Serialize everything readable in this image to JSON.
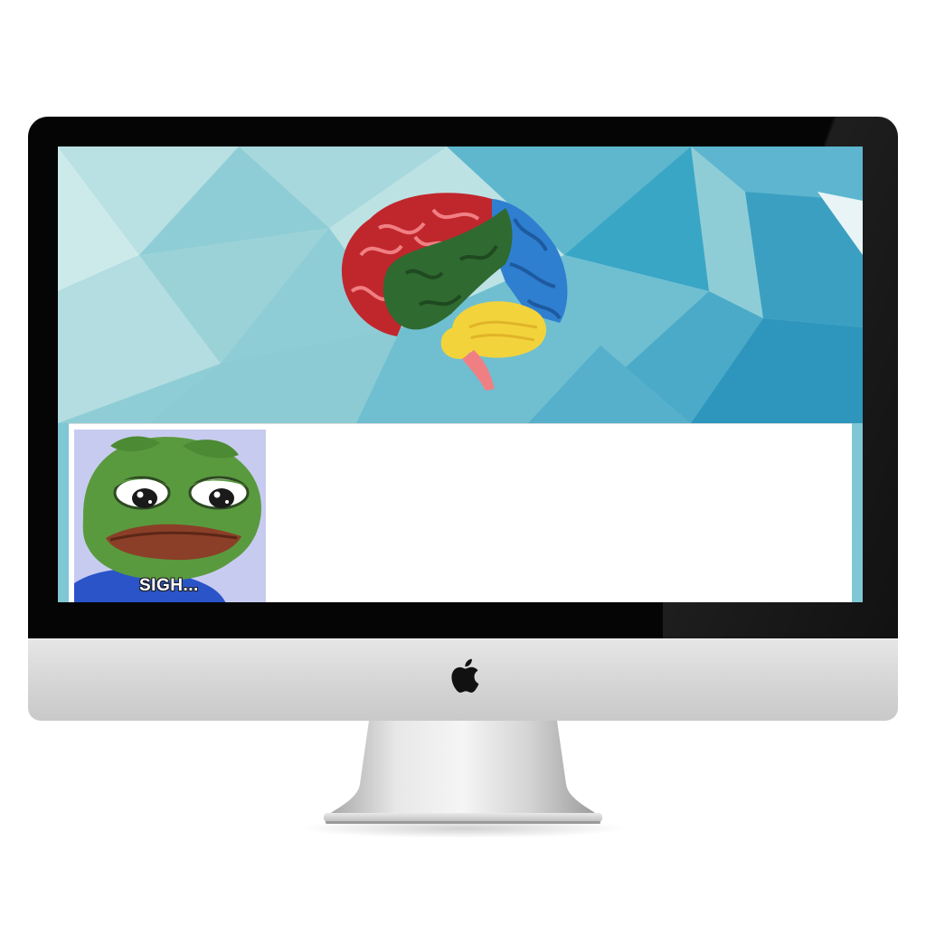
{
  "device": {
    "type": "desktop monitor",
    "logo_icon": "apple-logo-icon",
    "colors": {
      "bezel": "#050505",
      "chin": "#d9d9d9"
    }
  },
  "screen": {
    "wallpaper": {
      "icon": "brain-illustration",
      "colors": {
        "frontal": "#c0272d",
        "temporal": "#2f6a31",
        "parietal": "#2f7fd0",
        "cerebellum": "#f3d33b",
        "stem": "#f07f83",
        "background": "#7fc7d4"
      }
    },
    "panel": {
      "meme": {
        "icon": "sad-frog-image",
        "caption": "SIGH..."
      }
    }
  }
}
